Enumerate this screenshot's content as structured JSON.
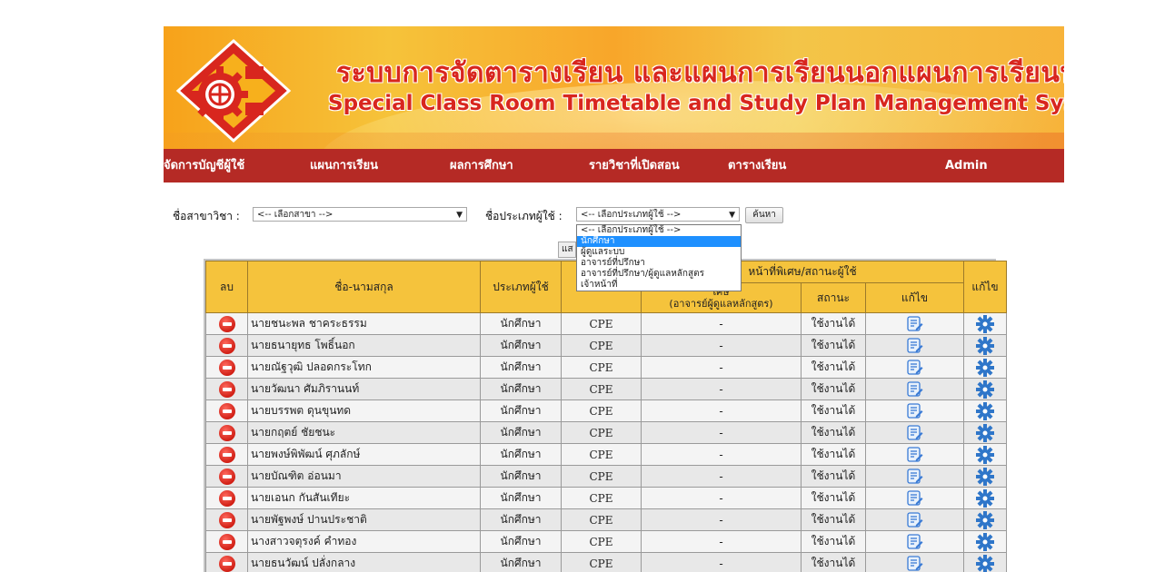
{
  "banner": {
    "title_th": "ระบบการจัดตารางเรียน และแผนการเรียนนอกแผนการเรียนปกติ",
    "title_en": "Special Class Room Timetable and Study Plan Management System"
  },
  "nav": {
    "items": [
      "จัดการบัญชีผู้ใช้",
      "แผนการเรียน",
      "ผลการศึกษา",
      "รายวิชาที่เปิดสอน",
      "ตารางเรียน"
    ],
    "user": "Admin"
  },
  "filters": {
    "major_label": "ชื่อสาขาวิชา :",
    "major_value": "<-- เลือกสาขา -->",
    "usertype_label": "ชื่อประเภทผู้ใช้ :",
    "usertype_value": "<-- เลือกประเภทผู้ใช้ -->",
    "search_button": "ค้นหา",
    "hidden_button": "แส",
    "usertype_options": [
      "<-- เลือกประเภทผู้ใช้ -->",
      "นักศึกษา",
      "ผู้ดูแลระบบ",
      "อาจารย์ที่ปรึกษา",
      "อาจารย์ที่ปรึกษา/ผู้ดูแลหลักสูตร",
      "เจ้าหน้าที่"
    ],
    "selected_option_index": 1
  },
  "table": {
    "headers": {
      "delete": "ลบ",
      "name": "ชื่อ-นามสกุล",
      "type": "ประเภทผู้ใช้",
      "special_group": "หน้าที่พิเศษ/สถานะผู้ใช้",
      "special_line1": "เศษ",
      "special_line2": "(อาจารย์ผู้ดูแลหลักสูตร)",
      "status": "สถานะ",
      "edit_status": "แก้ไข",
      "edit": "แก้ไข"
    },
    "rows": [
      {
        "name": "นายชนะพล ชาคระธรรม",
        "type": "นักศึกษา",
        "major": "CPE",
        "special": "-",
        "status": "ใช้งานได้"
      },
      {
        "name": "นายธนายุทธ โพธิ์นอก",
        "type": "นักศึกษา",
        "major": "CPE",
        "special": "-",
        "status": "ใช้งานได้"
      },
      {
        "name": "นายณัฐวุฒิ ปลอดกระโทก",
        "type": "นักศึกษา",
        "major": "CPE",
        "special": "-",
        "status": "ใช้งานได้"
      },
      {
        "name": "นายวัฒนา ศัมภิรานนท์",
        "type": "นักศึกษา",
        "major": "CPE",
        "special": "-",
        "status": "ใช้งานได้"
      },
      {
        "name": "นายบรรพต ดุนขุนทด",
        "type": "นักศึกษา",
        "major": "CPE",
        "special": "-",
        "status": "ใช้งานได้"
      },
      {
        "name": "นายกฤตย์ ชัยชนะ",
        "type": "นักศึกษา",
        "major": "CPE",
        "special": "-",
        "status": "ใช้งานได้"
      },
      {
        "name": "นายพงษ์พิพัฒน์ ศุภลักษ์",
        "type": "นักศึกษา",
        "major": "CPE",
        "special": "-",
        "status": "ใช้งานได้"
      },
      {
        "name": "นายบัณฑิต อ่อนมา",
        "type": "นักศึกษา",
        "major": "CPE",
        "special": "-",
        "status": "ใช้งานได้"
      },
      {
        "name": "นายเอนก กันสันเทียะ",
        "type": "นักศึกษา",
        "major": "CPE",
        "special": "-",
        "status": "ใช้งานได้"
      },
      {
        "name": "นายพัฐพงษ์ ปานประชาติ",
        "type": "นักศึกษา",
        "major": "CPE",
        "special": "-",
        "status": "ใช้งานได้"
      },
      {
        "name": "นางสาวจตุรงค์ คำทอง",
        "type": "นักศึกษา",
        "major": "CPE",
        "special": "-",
        "status": "ใช้งานได้"
      },
      {
        "name": "นายธนวัฒน์ ปลั่งกลาง",
        "type": "นักศึกษา",
        "major": "CPE",
        "special": "-",
        "status": "ใช้งานได้"
      }
    ]
  },
  "colors": {
    "nav_bg": "#b52a25",
    "header_bg": "#f5c33c",
    "title_red": "#d8261e",
    "select_highlight": "#1e90ff"
  }
}
